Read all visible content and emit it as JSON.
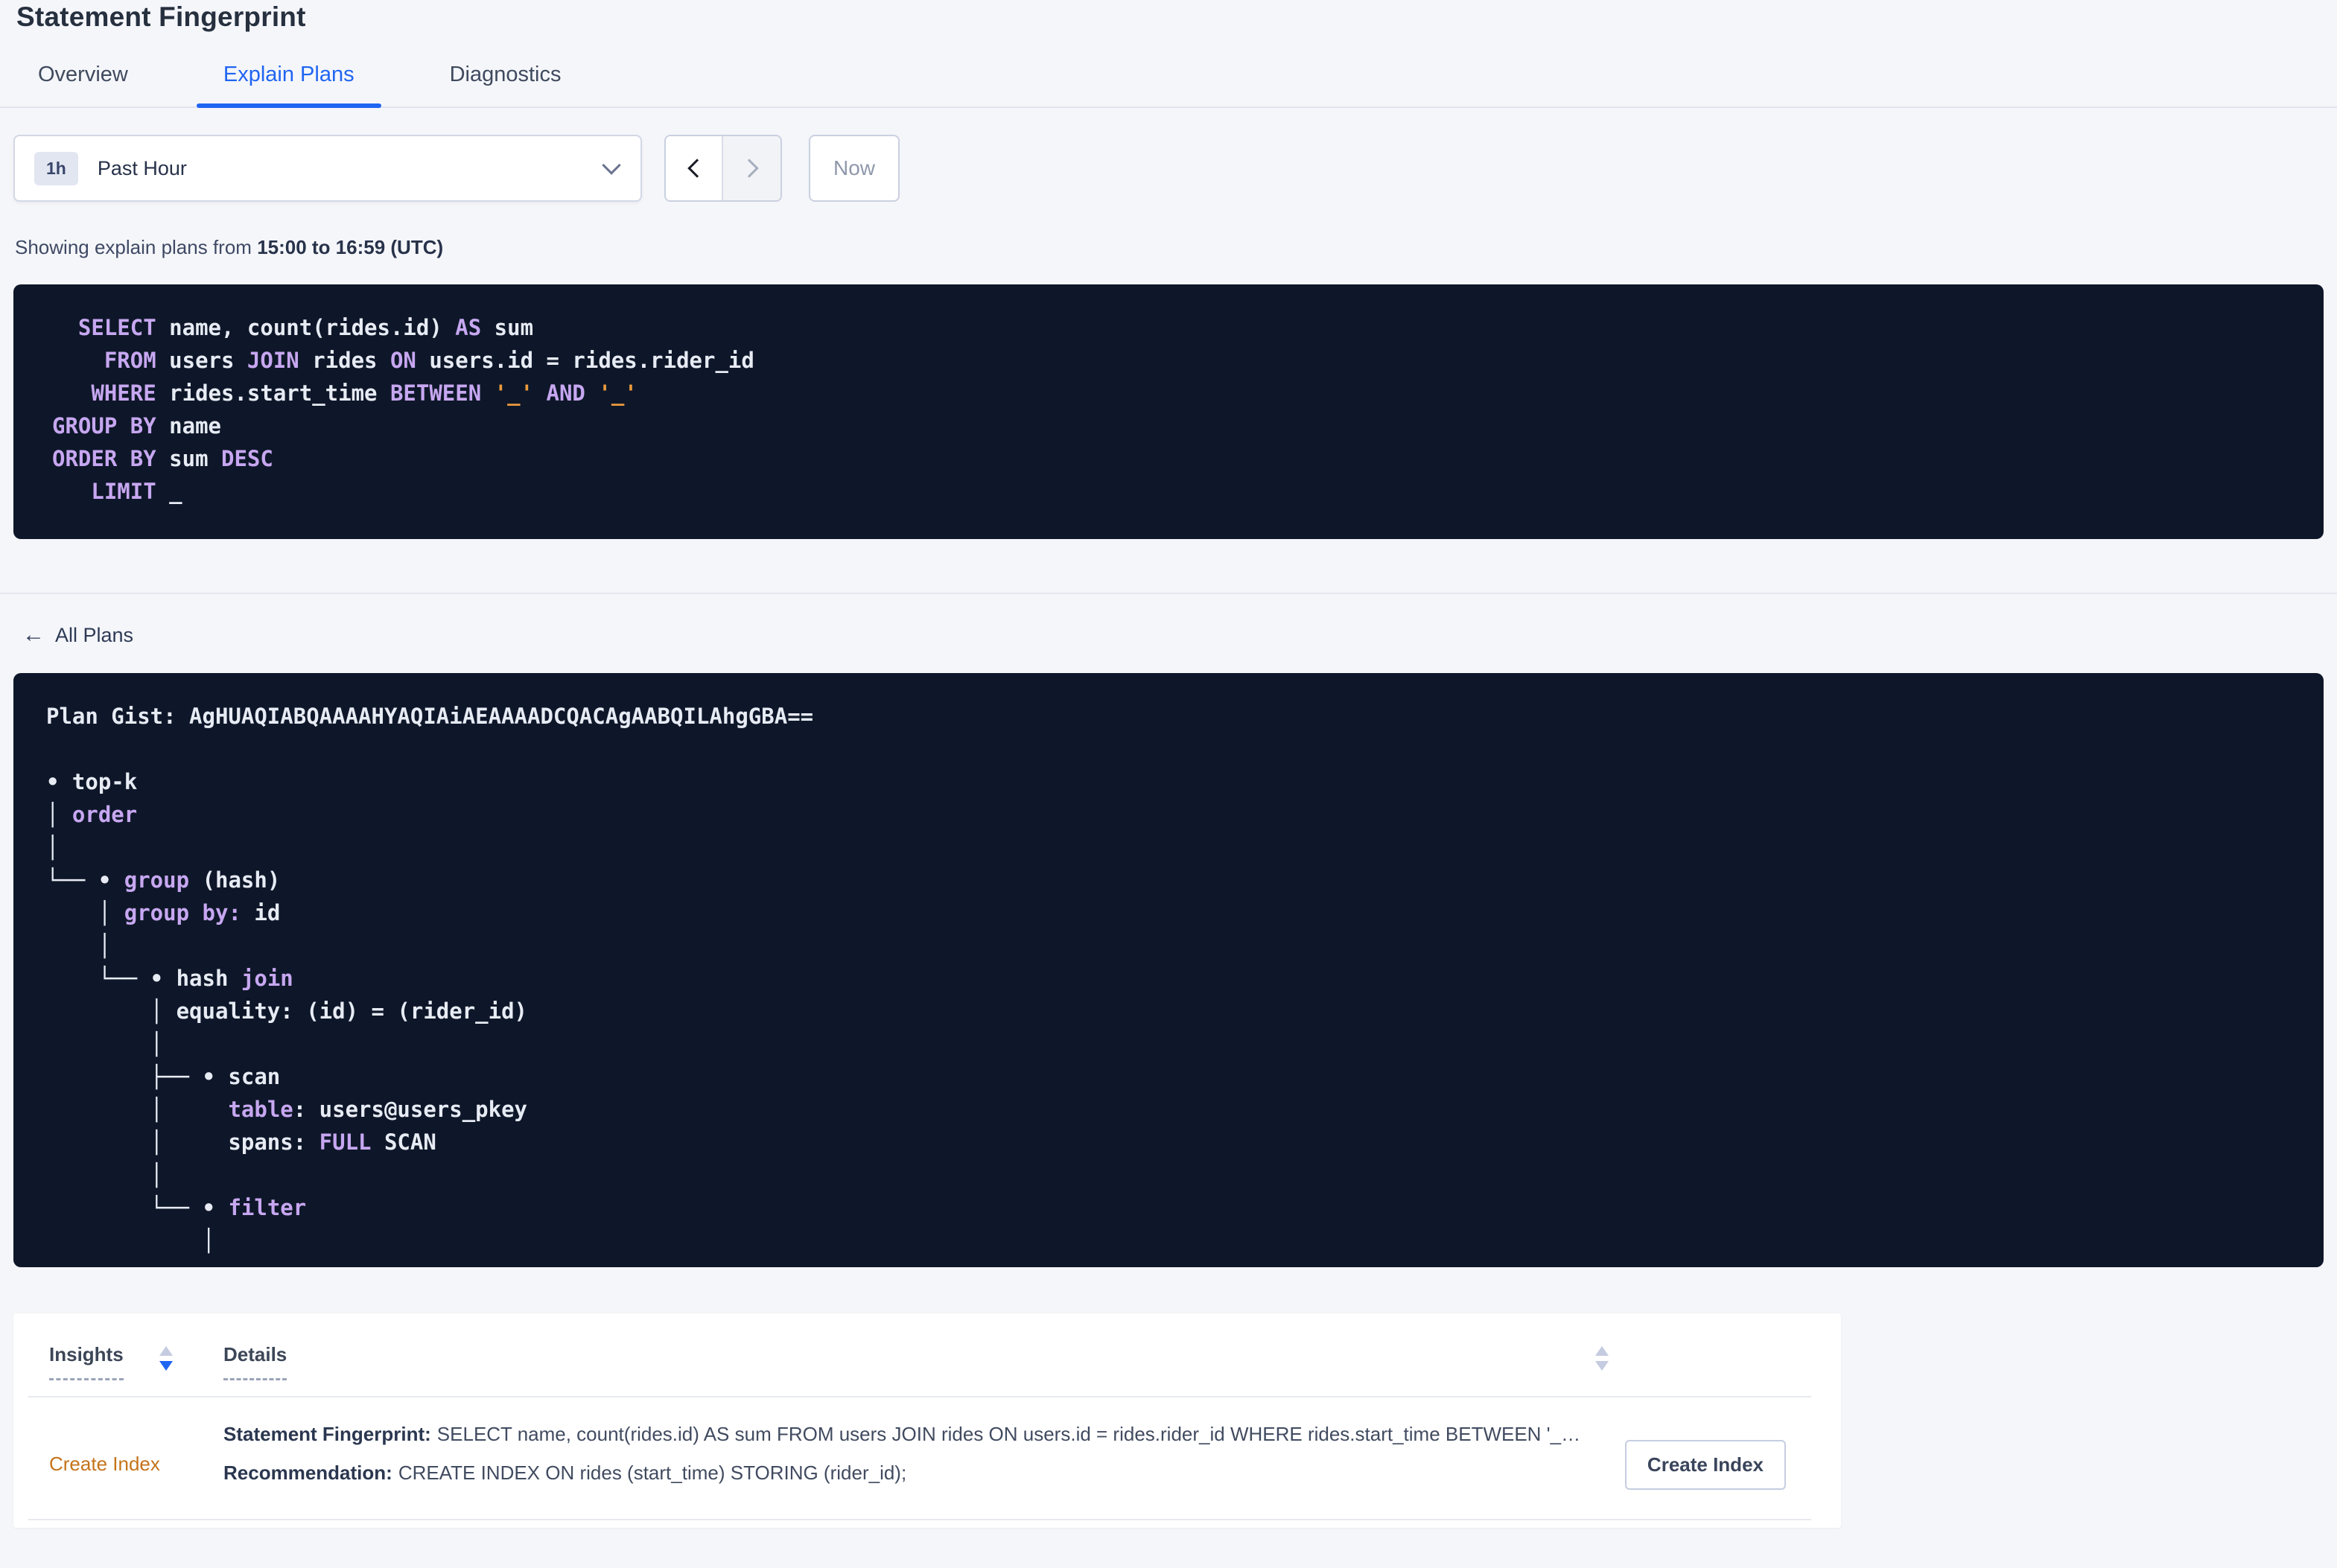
{
  "colors": {
    "accent-blue": "#2065f2",
    "code-keyword": "#c7a7f1",
    "code-text": "#e7ebf4",
    "code-literal": "#eb9a3d",
    "panel-bg": "#0e1729",
    "link-orange": "#c4731b"
  },
  "page": {
    "title": "Statement Fingerprint"
  },
  "tabs": [
    {
      "label": "Overview",
      "active": false
    },
    {
      "label": "Explain Plans",
      "active": true
    },
    {
      "label": "Diagnostics",
      "active": false
    }
  ],
  "time_selector": {
    "badge": "1h",
    "label": "Past Hour",
    "now_label": "Now",
    "icons": {
      "dropdown": "chevron-down-icon",
      "prev": "chevron-left-icon",
      "next": "chevron-right-icon"
    }
  },
  "showing": {
    "prefix": "Showing explain plans from ",
    "range": "15:00 to 16:59 (UTC)"
  },
  "sql": {
    "lines": [
      [
        {
          "t": "  SELECT",
          "c": "k"
        },
        {
          "t": " name, count(rides.id) ",
          "c": "w"
        },
        {
          "t": "AS",
          "c": "k"
        },
        {
          "t": " sum",
          "c": "w"
        }
      ],
      [
        {
          "t": "    FROM",
          "c": "k"
        },
        {
          "t": " users ",
          "c": "w"
        },
        {
          "t": "JOIN",
          "c": "k"
        },
        {
          "t": " rides ",
          "c": "w"
        },
        {
          "t": "ON",
          "c": "k"
        },
        {
          "t": " users.id = rides.rider_id",
          "c": "w"
        }
      ],
      [
        {
          "t": "   WHERE",
          "c": "k"
        },
        {
          "t": " rides.start_time ",
          "c": "w"
        },
        {
          "t": "BETWEEN",
          "c": "k"
        },
        {
          "t": " ",
          "c": "w"
        },
        {
          "t": "'_'",
          "c": "o"
        },
        {
          "t": " ",
          "c": "w"
        },
        {
          "t": "AND",
          "c": "k"
        },
        {
          "t": " ",
          "c": "w"
        },
        {
          "t": "'_'",
          "c": "o"
        }
      ],
      [
        {
          "t": "GROUP BY",
          "c": "k"
        },
        {
          "t": " name",
          "c": "w"
        }
      ],
      [
        {
          "t": "ORDER BY",
          "c": "k"
        },
        {
          "t": " sum ",
          "c": "w"
        },
        {
          "t": "DESC",
          "c": "k"
        }
      ],
      [
        {
          "t": "   LIMIT",
          "c": "k"
        },
        {
          "t": " _",
          "c": "w"
        }
      ]
    ]
  },
  "all_plans": {
    "label": "All Plans",
    "icon": "arrow-left-icon"
  },
  "plan": {
    "lines": [
      [
        {
          "t": "Plan Gist: AgHUAQIABQAAAAHYAQIAiAEAAAADCQACAgAABQILAhgGBA==",
          "c": "w"
        }
      ],
      [],
      [
        {
          "t": "• top-k",
          "c": "w"
        }
      ],
      [
        {
          "t": "│ ",
          "c": "w"
        },
        {
          "t": "order",
          "c": "k"
        }
      ],
      [
        {
          "t": "│",
          "c": "w"
        }
      ],
      [
        {
          "t": "└── • ",
          "c": "w"
        },
        {
          "t": "group",
          "c": "k"
        },
        {
          "t": " (hash)",
          "c": "w"
        }
      ],
      [
        {
          "t": "    │ ",
          "c": "w"
        },
        {
          "t": "group by:",
          "c": "k"
        },
        {
          "t": " id",
          "c": "w"
        }
      ],
      [
        {
          "t": "    │",
          "c": "w"
        }
      ],
      [
        {
          "t": "    └── • hash ",
          "c": "w"
        },
        {
          "t": "join",
          "c": "k"
        }
      ],
      [
        {
          "t": "        │ equality: (id) = (rider_id)",
          "c": "w"
        }
      ],
      [
        {
          "t": "        │",
          "c": "w"
        }
      ],
      [
        {
          "t": "        ├── • scan",
          "c": "w"
        }
      ],
      [
        {
          "t": "        │     ",
          "c": "w"
        },
        {
          "t": "table",
          "c": "k"
        },
        {
          "t": ": users@users_pkey",
          "c": "w"
        }
      ],
      [
        {
          "t": "        │     spans: ",
          "c": "w"
        },
        {
          "t": "FULL",
          "c": "k"
        },
        {
          "t": " SCAN",
          "c": "w"
        }
      ],
      [
        {
          "t": "        │",
          "c": "w"
        }
      ],
      [
        {
          "t": "        └── • ",
          "c": "w"
        },
        {
          "t": "filter",
          "c": "k"
        }
      ],
      [
        {
          "t": "            │",
          "c": "w"
        }
      ]
    ]
  },
  "insights_table": {
    "columns": [
      {
        "label": "Insights",
        "sort": "desc"
      },
      {
        "label": "Details",
        "sort": "none"
      }
    ],
    "row": {
      "insight": "Create Index",
      "statement_label": "Statement Fingerprint:",
      "statement_text": "SELECT name, count(rides.id) AS sum FROM users JOIN rides ON users.id = rides.rider_id WHERE rides.start_time BETWEEN '_…",
      "recommendation_label": "Recommendation:",
      "recommendation_text": "CREATE INDEX ON rides (start_time) STORING (rider_id);",
      "button_label": "Create Index"
    }
  }
}
